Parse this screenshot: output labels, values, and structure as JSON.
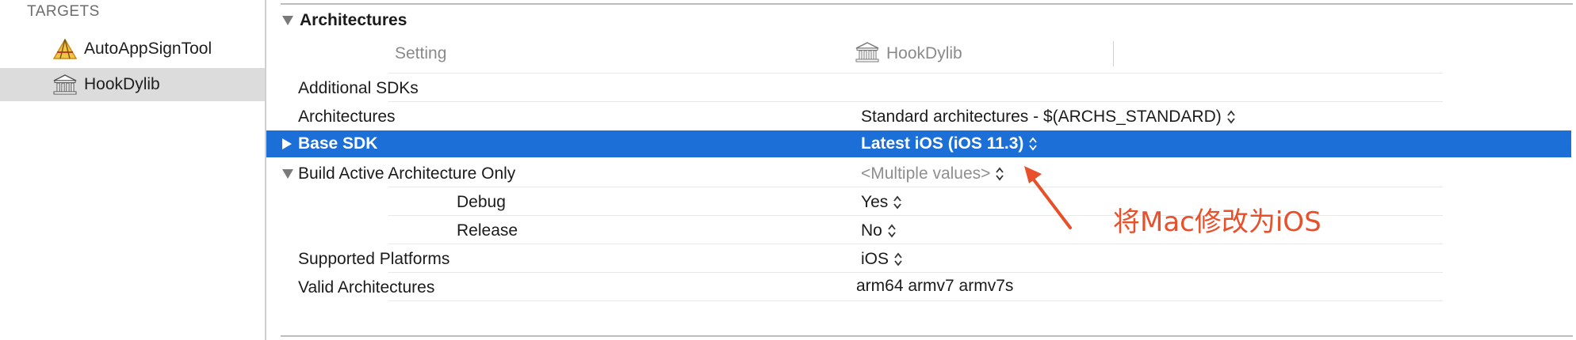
{
  "sidebar": {
    "header": "TARGETS",
    "items": [
      {
        "label": "AutoAppSignTool",
        "icon": "xcode-app-icon",
        "selected": false
      },
      {
        "label": "HookDylib",
        "icon": "library-building-icon",
        "selected": true
      }
    ]
  },
  "section": {
    "title": "Architectures",
    "column_setting": "Setting",
    "column_target": "HookDylib"
  },
  "rows": [
    {
      "label": "Additional SDKs",
      "value": ""
    },
    {
      "label": "Architectures",
      "value": "Standard architectures  -  $(ARCHS_STANDARD)"
    },
    {
      "label": "Base SDK",
      "value": "Latest iOS (iOS 11.3)"
    },
    {
      "label": "Build Active Architecture Only",
      "value": "<Multiple values>"
    },
    {
      "label": "Debug",
      "value": "Yes"
    },
    {
      "label": "Release",
      "value": "No"
    },
    {
      "label": "Supported Platforms",
      "value": "iOS"
    },
    {
      "label": "Valid Architectures",
      "value": "arm64 armv7 armv7s"
    }
  ],
  "annotation": {
    "text": "将Mac修改为iOS",
    "color": "#e8502b"
  },
  "colors": {
    "selection": "#1c6fd6",
    "sidebar_selection": "#dcdcdc"
  }
}
